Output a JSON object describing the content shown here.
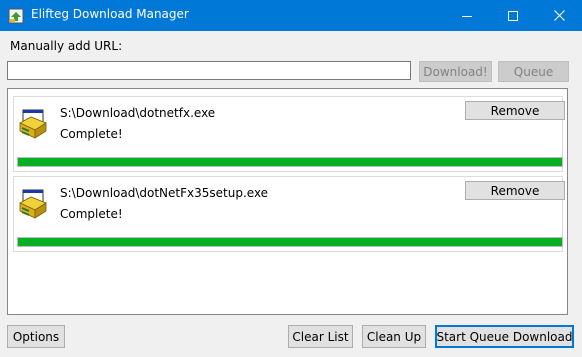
{
  "window": {
    "title": "Elifteg Download Manager"
  },
  "url_section": {
    "label": "Manually add URL:",
    "input_value": "",
    "download_button": "Download!",
    "queue_button": "Queue"
  },
  "downloads": [
    {
      "path": "S:\\Download\\dotnetfx.exe",
      "status": "Complete!",
      "progress": 1.0,
      "remove_label": "Remove",
      "icon": "installer-icon"
    },
    {
      "path": "S:\\Download\\dotNetFx35setup.exe",
      "status": "Complete!",
      "progress": 1.0,
      "remove_label": "Remove",
      "icon": "installer-icon"
    }
  ],
  "footer": {
    "options_button": "Options",
    "clear_list_button": "Clear List",
    "clean_up_button": "Clean Up",
    "start_queue_button": "Start Queue Download"
  },
  "colors": {
    "titlebar": "#0078d7",
    "progress": "#06b025"
  }
}
